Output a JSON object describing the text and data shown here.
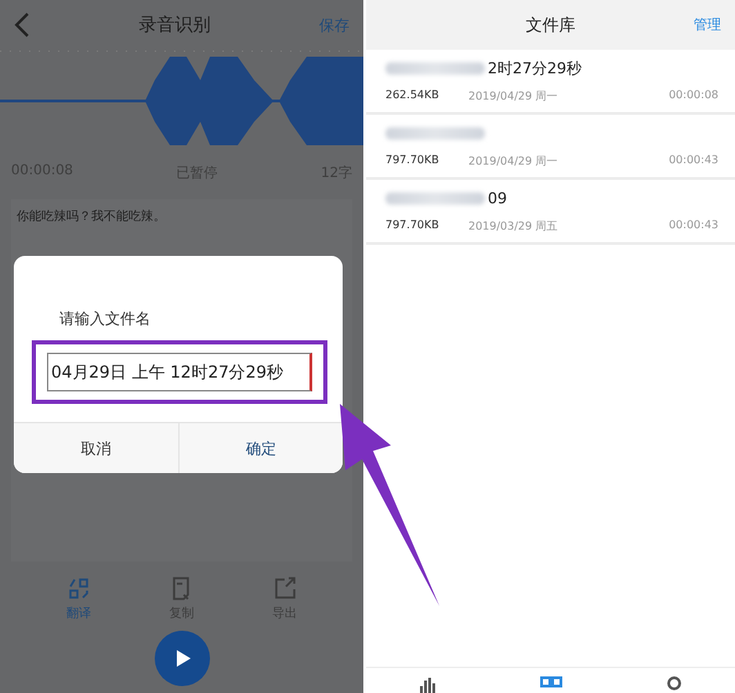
{
  "recorder": {
    "title": "录音识别",
    "save": "保存",
    "elapsed": "00:00:08",
    "status": "已暂停",
    "char_count": "12字",
    "transcript": "你能吃辣吗？我不能吃辣。",
    "actions": [
      {
        "label": "翻译",
        "kind": "translate",
        "selected": true
      },
      {
        "label": "复制",
        "kind": "copy",
        "selected": false
      },
      {
        "label": "导出",
        "kind": "export",
        "selected": false
      }
    ]
  },
  "dialog": {
    "prompt": "请输入文件名",
    "value": "04月29日 上午 12时27分29秒",
    "highlighted": true,
    "buttons": [
      {
        "label": "取消",
        "kind": "cancel"
      },
      {
        "label": "确定",
        "kind": "confirm"
      }
    ]
  },
  "library": {
    "title": "文件库",
    "manage": "管理",
    "files": [
      {
        "name": "2时27分29秒",
        "blurred": true,
        "size": "262.54KB",
        "date": "2019/04/29 周一",
        "duration": "00:00:08"
      },
      {
        "blurred": true,
        "size": "797.70KB",
        "date": "2019/04/29 周一",
        "duration": "00:00:43"
      },
      {
        "name": "09",
        "blurred": true,
        "size": "797.70KB",
        "date": "2019/03/29 周五",
        "duration": "00:00:43"
      }
    ],
    "nav": [
      {
        "kind": "bars",
        "selected": false
      },
      {
        "kind": "grid",
        "selected": true
      },
      {
        "kind": "person",
        "selected": false
      }
    ]
  }
}
